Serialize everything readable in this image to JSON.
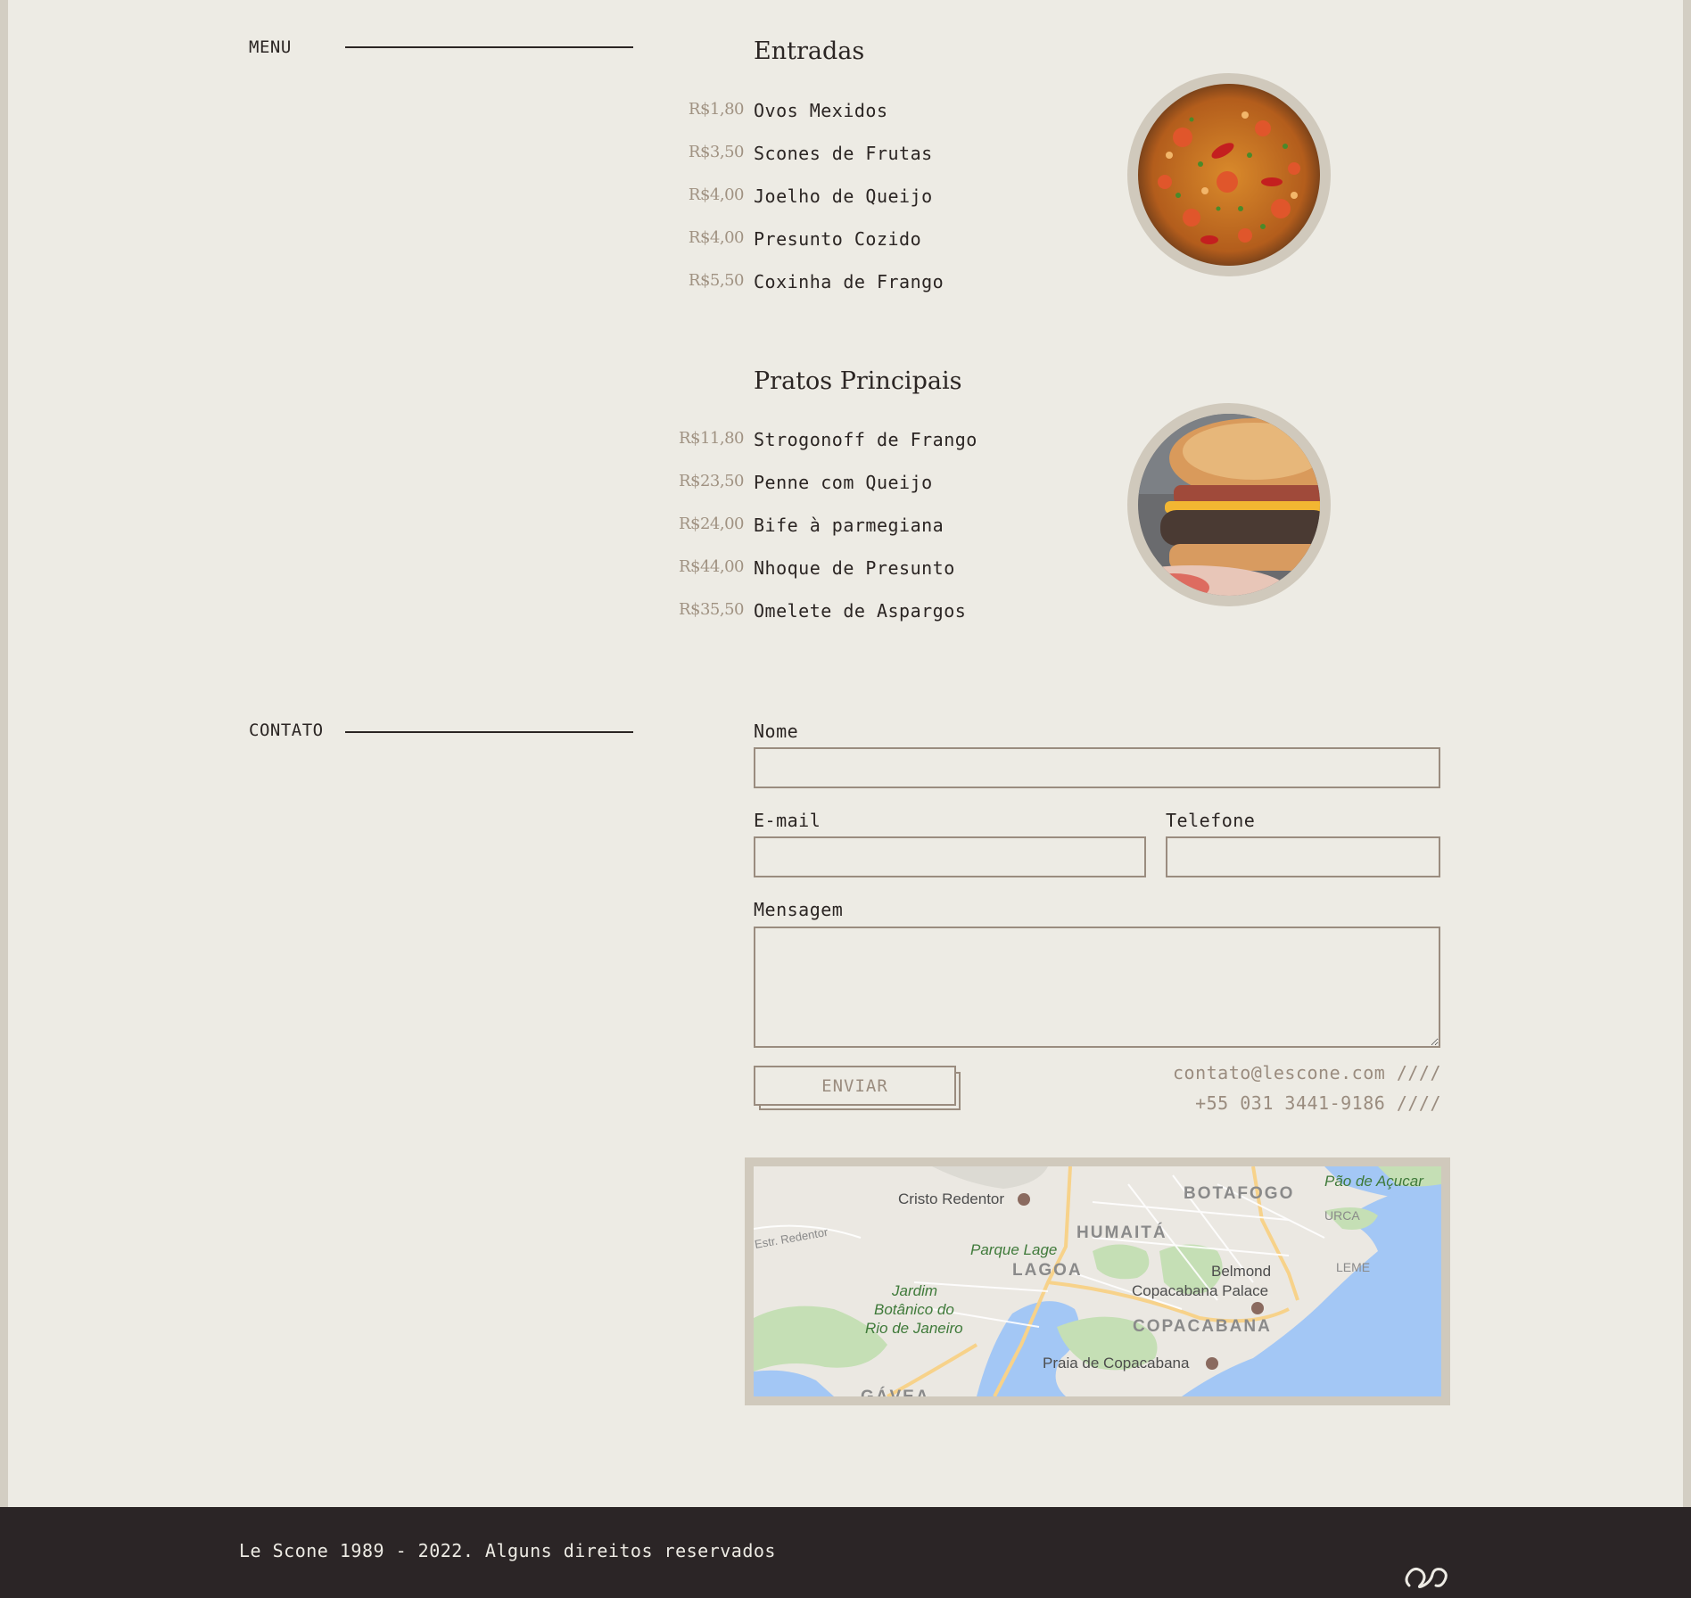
{
  "sections": {
    "menu_label": "MENU",
    "contact_label": "CONTATO"
  },
  "menu": {
    "categories": [
      {
        "title": "Entradas",
        "photo_icon": "paella-dish-photo",
        "items": [
          {
            "price": "R$1,80",
            "name": "Ovos Mexidos"
          },
          {
            "price": "R$3,50",
            "name": "Scones de Frutas"
          },
          {
            "price": "R$4,00",
            "name": "Joelho de Queijo"
          },
          {
            "price": "R$4,00",
            "name": "Presunto Cozido"
          },
          {
            "price": "R$5,50",
            "name": "Coxinha de Frango"
          }
        ]
      },
      {
        "title": "Pratos Principais",
        "photo_icon": "burger-photo",
        "items": [
          {
            "price": "R$11,80",
            "name": "Strogonoff de Frango"
          },
          {
            "price": "R$23,50",
            "name": "Penne com Queijo"
          },
          {
            "price": "R$24,00",
            "name": "Bife à parmegiana"
          },
          {
            "price": "R$44,00",
            "name": "Nhoque de Presunto"
          },
          {
            "price": "R$35,50",
            "name": "Omelete de Aspargos"
          }
        ]
      }
    ]
  },
  "contact_form": {
    "name_label": "Nome",
    "name_value": "",
    "email_label": "E-mail",
    "email_value": "",
    "phone_label": "Telefone",
    "phone_value": "",
    "message_label": "Mensagem",
    "message_value": "",
    "submit_label": "ENVIAR"
  },
  "contact_info": {
    "email": "contato@lescone.com ////",
    "phone": "+55 031 3441-9186 ////"
  },
  "map": {
    "labels": {
      "cristo": "Cristo Redentor",
      "pao": "Pão de Açucar",
      "botafogo": "BOTAFOGO",
      "urca": "URCA",
      "humaita": "HUMAITÁ",
      "parque": "Parque Lage",
      "lagoa": "LAGOA",
      "leme": "LEME",
      "belmond1": "Belmond",
      "belmond2": "Copacabana Palace",
      "jardim1": "Jardim",
      "jardim2": "Botânico do",
      "jardim3": "Rio de Janeiro",
      "copacabana": "COPACABANA",
      "praia": "Praia de Copacabana",
      "estr": "Estr. Redentor",
      "gavea": "GÁVEA"
    },
    "colors": {
      "land": "#ebe8e2",
      "water": "#a3c7f5",
      "park": "#c5dfb5",
      "road": "#f7d28a"
    }
  },
  "footer": {
    "copyright": "Le Scone 1989 - 2022. Alguns direitos reservados",
    "logo_icon": "scone-swirl-logo"
  },
  "colors": {
    "background": "#edebe4",
    "accent_muted": "#9a8c7f",
    "text": "#2b2523",
    "footer": "#2b2526"
  }
}
